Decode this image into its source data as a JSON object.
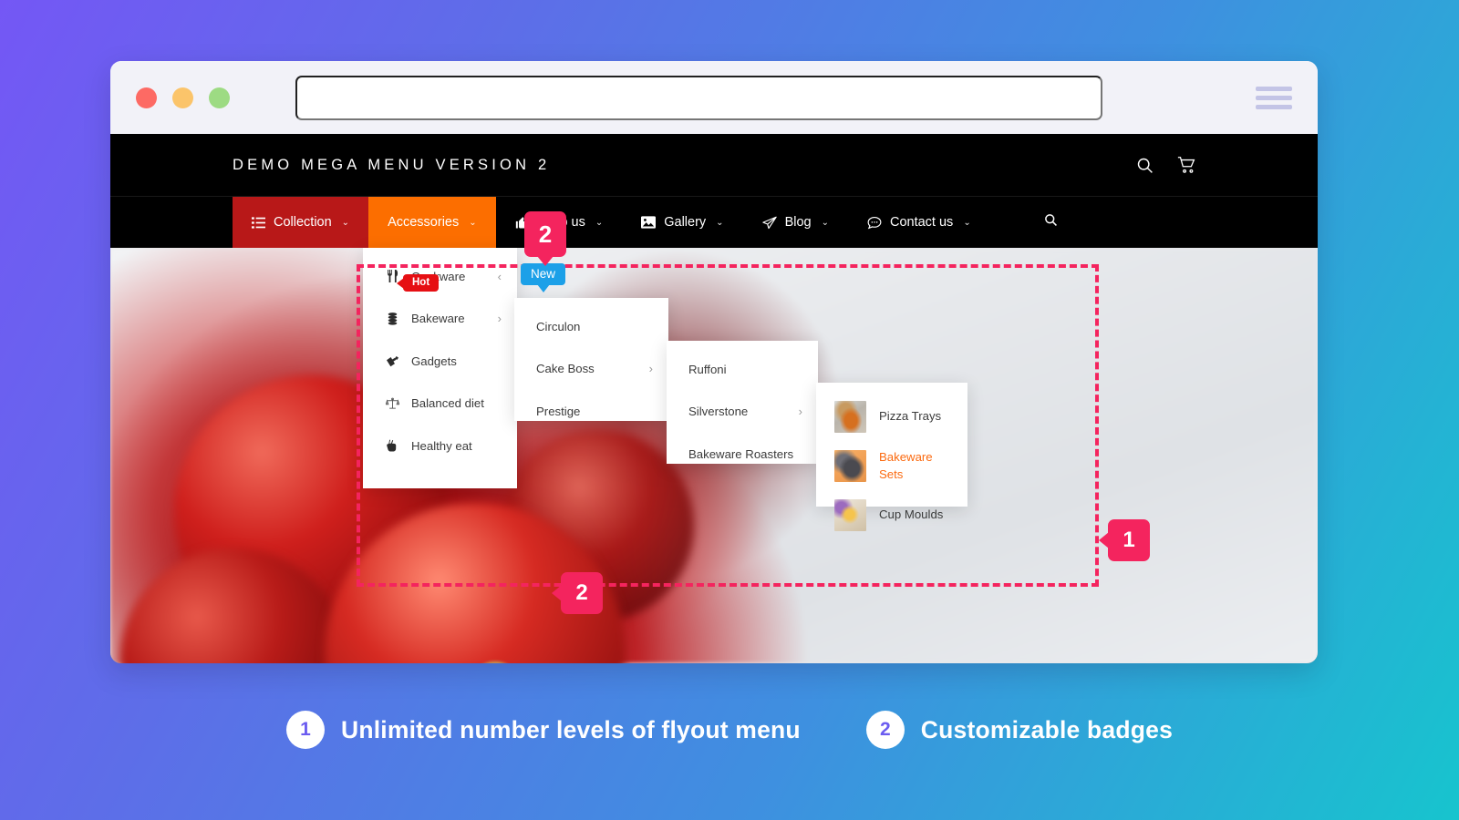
{
  "browser": {
    "traffic_lights": [
      "close",
      "minimize",
      "zoom"
    ],
    "url_value": "",
    "url_placeholder": "",
    "menu_icon": "hamburger-icon"
  },
  "site": {
    "brand": "DEMO MEGA MENU VERSION 2",
    "header_icons": [
      "search-icon",
      "cart-icon"
    ],
    "nav": [
      {
        "label": "Collection",
        "icon": "list-icon",
        "caret": "⌄",
        "state": "active-red"
      },
      {
        "label": "Accessories",
        "icon": "",
        "caret": "⌄",
        "state": "active-orange"
      },
      {
        "label": "Shop us",
        "icon": "thumbs-up-icon",
        "caret": "⌄",
        "state": "",
        "badge": "New"
      },
      {
        "label": "Gallery",
        "icon": "image-icon",
        "caret": "⌄",
        "state": ""
      },
      {
        "label": "Blog",
        "icon": "paper-plane-icon",
        "caret": "⌄",
        "state": ""
      },
      {
        "label": "Contact us",
        "icon": "comment-icon",
        "caret": "⌄",
        "state": ""
      }
    ],
    "nav_search_icon": "search-icon"
  },
  "menus": {
    "level1": [
      {
        "label": "Cookware",
        "icon": "cutlery-icon",
        "arrow": "‹"
      },
      {
        "label": "Bakeware",
        "icon": "layers-icon",
        "arrow": "›"
      },
      {
        "label": "Gadgets",
        "icon": "gadget-icon",
        "arrow": ""
      },
      {
        "label": "Balanced diet",
        "icon": "scale-icon",
        "arrow": ""
      },
      {
        "label": "Healthy eat",
        "icon": "hand-peace-icon",
        "arrow": "",
        "badge": "Hot"
      }
    ],
    "level2": [
      {
        "label": "Circulon",
        "arrow": ""
      },
      {
        "label": "Cake Boss",
        "arrow": "›"
      },
      {
        "label": "Prestige",
        "arrow": ""
      }
    ],
    "level3": [
      {
        "label": "Ruffoni",
        "arrow": ""
      },
      {
        "label": "Silverstone",
        "arrow": "›"
      },
      {
        "label": "Bakeware Roasters",
        "arrow": ""
      }
    ],
    "level4": [
      {
        "label": "Pizza Trays",
        "thumb": "pizza-tray-thumb",
        "highlight": false
      },
      {
        "label": "Bakeware Sets",
        "thumb": "bakeware-set-thumb",
        "highlight": true
      },
      {
        "label": "Cup Moulds",
        "thumb": "cup-mould-thumb",
        "highlight": false
      }
    ]
  },
  "markers": {
    "header_badge": "2",
    "flyout": "1",
    "menu_badge": "2"
  },
  "captions": [
    {
      "num": "1",
      "text": "Unlimited number levels of flyout menu"
    },
    {
      "num": "2",
      "text": "Customizable badges"
    }
  ],
  "colors": {
    "accent_pink": "#f4245e",
    "nav_red": "#b81818",
    "nav_orange": "#fc6e00",
    "badge_blue": "#1ca0e8",
    "badge_red": "#e60f13",
    "highlight_orange": "#fb6a10"
  }
}
